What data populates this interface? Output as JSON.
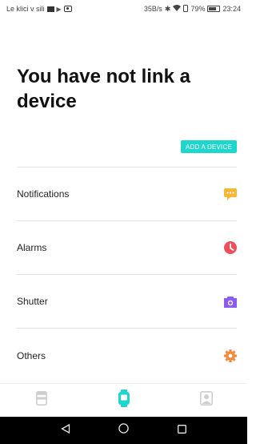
{
  "status_bar": {
    "left_text": "Le klici v sili",
    "speed": "35B/s",
    "battery": "79%",
    "time": "23:24"
  },
  "main": {
    "title": "You have not link a device",
    "add_device_label": "ADD A DEVICE"
  },
  "menu": {
    "items": [
      {
        "label": "Notifications",
        "icon": "chat-bubble-icon",
        "color": "#f7b733"
      },
      {
        "label": "Alarms",
        "icon": "clock-icon",
        "color": "#ef4f5a"
      },
      {
        "label": "Shutter",
        "icon": "camera-icon",
        "color": "#8a5cf5"
      },
      {
        "label": "Others",
        "icon": "gear-icon",
        "color": "#f58a3c"
      }
    ]
  },
  "tab_bar": {
    "accent": "#1fd6cc",
    "inactive": "#cfcfcf",
    "tabs": [
      "device-list-icon",
      "watch-icon",
      "profile-icon"
    ]
  },
  "nav_bar": {
    "buttons": [
      "back-icon",
      "home-icon",
      "recents-icon"
    ]
  }
}
